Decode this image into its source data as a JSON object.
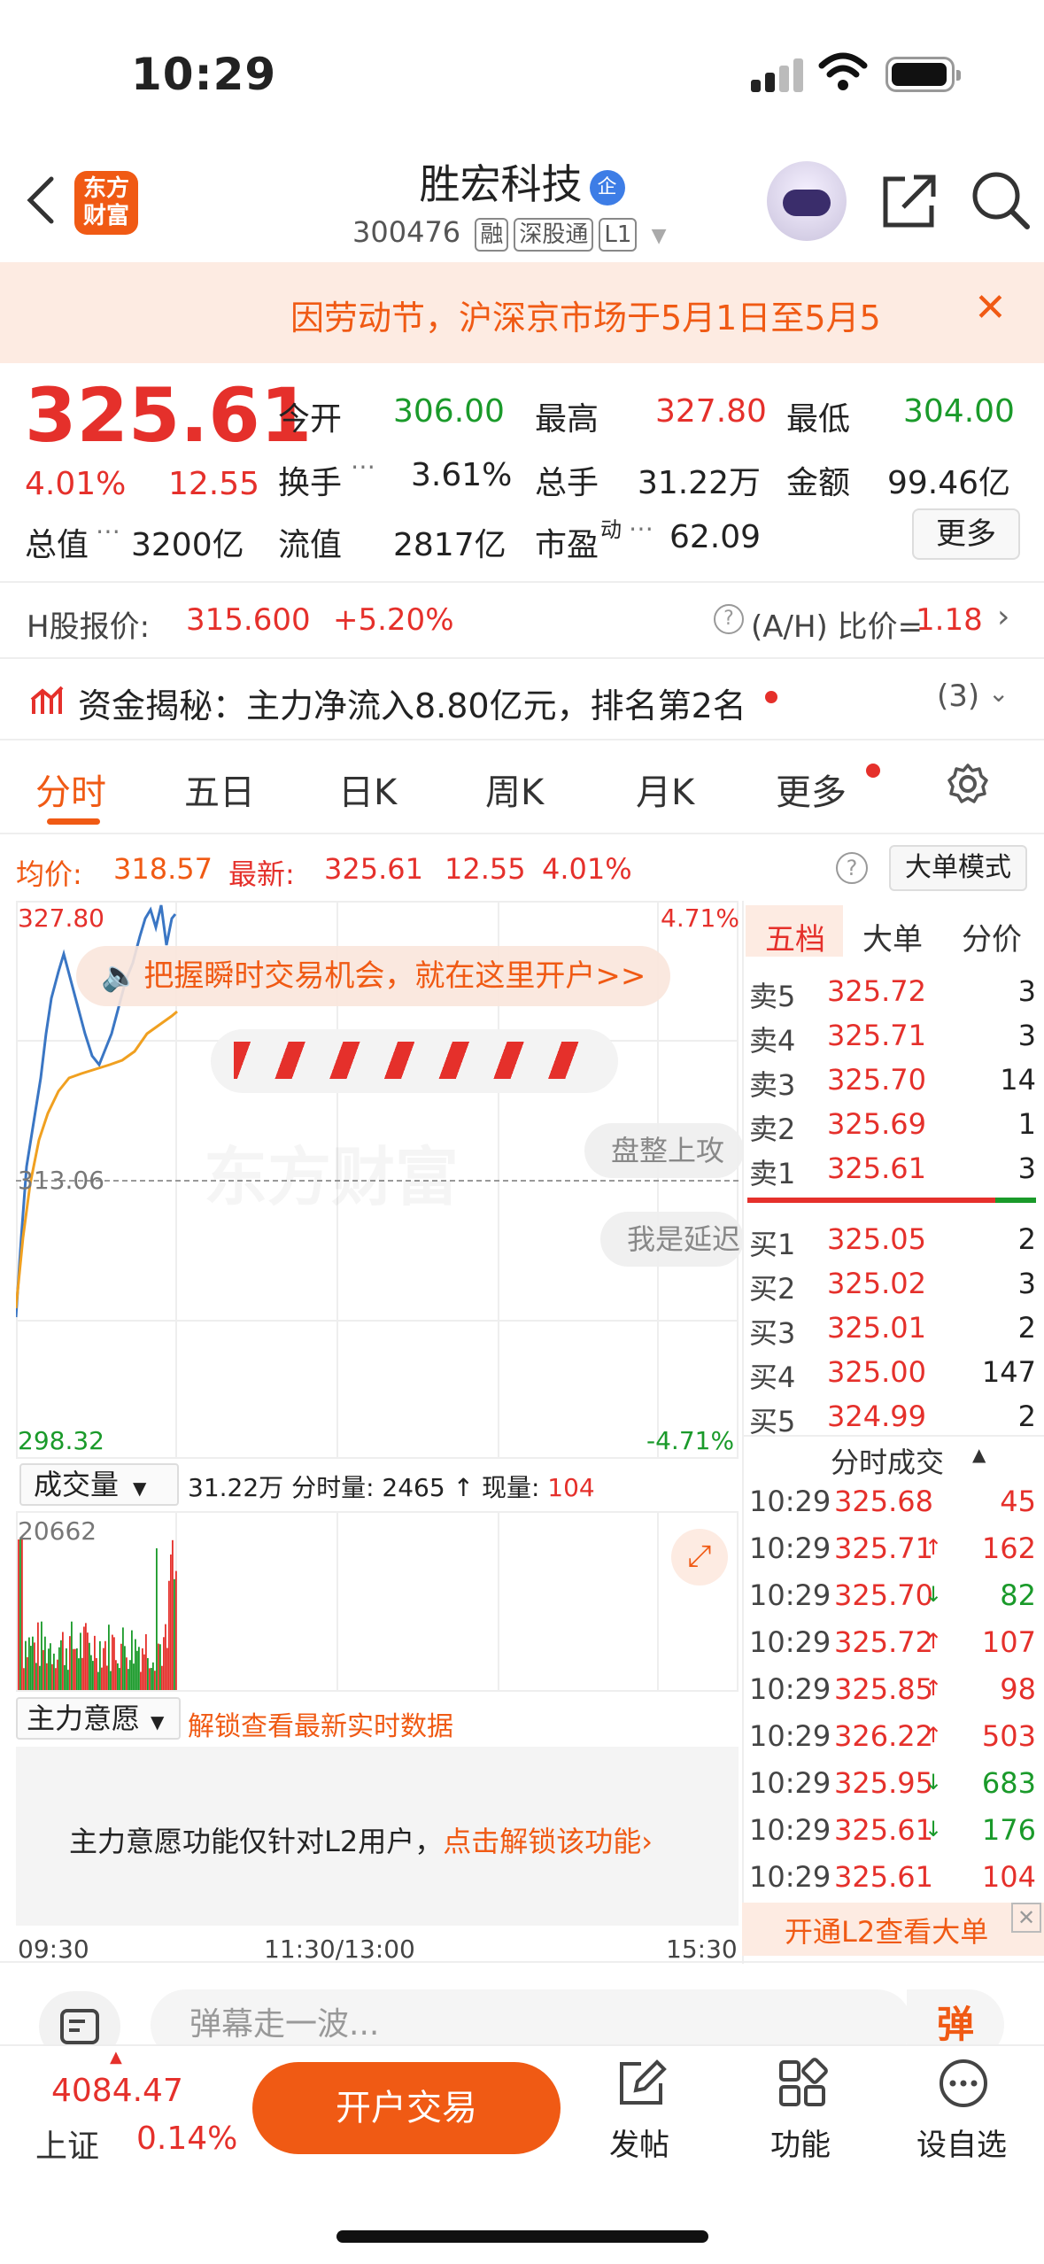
{
  "status": {
    "time": "10:29"
  },
  "header": {
    "logo_line1": "东方",
    "logo_line2": "财富",
    "stock_name": "胜宏科技",
    "qi_badge": "企",
    "code": "300476",
    "tags": [
      "融",
      "深股通",
      "L1"
    ]
  },
  "notice": {
    "text": "因劳动节，沪深京市场于5月1日至5月5",
    "close": "✕"
  },
  "quote": {
    "price": "325.61",
    "change_pct": "4.01%",
    "change": "12.55",
    "open_label": "今开",
    "open": "306.00",
    "high_label": "最高",
    "high": "327.80",
    "low_label": "最低",
    "low": "304.00",
    "turnover_label": "换手",
    "turnover": "3.61%",
    "volume_label": "总手",
    "volume": "31.22万",
    "amount_label": "金额",
    "amount": "99.46亿",
    "mcap_label": "总值",
    "mcap": "3200亿",
    "float_label": "流值",
    "float": "2817亿",
    "pe_label": "市盈",
    "pe_sup": "动",
    "pe": "62.09",
    "more": "更多"
  },
  "hshare": {
    "label": "H股报价:",
    "price": "315.600",
    "pct": "+5.20%",
    "ratio": "(A/H) 比价=",
    "ratio_val": "1.18"
  },
  "capital": {
    "text": "资金揭秘：主力净流入8.80亿元，排名第2名",
    "count": "(3)"
  },
  "tabs": [
    "分时",
    "五日",
    "日K",
    "周K",
    "月K",
    "更多"
  ],
  "chart_info": {
    "avg_label": "均价:",
    "avg": "318.57",
    "latest_label": "最新:",
    "latest": "325.61",
    "chg": "12.55",
    "pct": "4.01%",
    "mode": "大单模式"
  },
  "chart": {
    "y_top": "327.80",
    "y_mid": "313.06",
    "y_bot": "298.32",
    "pct_top": "4.71%",
    "pct_bot": "-4.71%",
    "promo": "把握瞬时交易机会，就在这里开户>>",
    "watermark": "东方财富",
    "danmu1": "盘整上攻",
    "danmu2": "我是延迟"
  },
  "volume": {
    "selector": "成交量",
    "summary_total": "31.22万",
    "summary_min_label": "分时量:",
    "summary_min": "2465",
    "summary_now_label": "现量:",
    "summary_now": "104",
    "max": "20662"
  },
  "main_force": {
    "selector": "主力意愿",
    "unlock": "解锁查看最新实时数据",
    "msg": "主力意愿功能仅针对L2用户，",
    "link": "点击解锁该功能"
  },
  "time_axis": [
    "09:30",
    "11:30/13:00",
    "15:30"
  ],
  "orderbook": {
    "tabs": [
      "五档",
      "大单",
      "分价"
    ],
    "asks": [
      {
        "l": "卖5",
        "p": "325.72",
        "v": "3"
      },
      {
        "l": "卖4",
        "p": "325.71",
        "v": "3"
      },
      {
        "l": "卖3",
        "p": "325.70",
        "v": "14"
      },
      {
        "l": "卖2",
        "p": "325.69",
        "v": "1"
      },
      {
        "l": "卖1",
        "p": "325.61",
        "v": "3"
      }
    ],
    "bids": [
      {
        "l": "买1",
        "p": "325.05",
        "v": "2"
      },
      {
        "l": "买2",
        "p": "325.02",
        "v": "3"
      },
      {
        "l": "买3",
        "p": "325.01",
        "v": "2"
      },
      {
        "l": "买4",
        "p": "325.00",
        "v": "147"
      },
      {
        "l": "买5",
        "p": "324.99",
        "v": "2"
      }
    ]
  },
  "trades": {
    "title": "分时成交",
    "rows": [
      {
        "t": "10:29",
        "p": "325.68",
        "v": "45",
        "d": "",
        "c": "red"
      },
      {
        "t": "10:29",
        "p": "325.71",
        "v": "162",
        "d": "↑",
        "c": "red"
      },
      {
        "t": "10:29",
        "p": "325.70",
        "v": "82",
        "d": "↓",
        "c": "green"
      },
      {
        "t": "10:29",
        "p": "325.72",
        "v": "107",
        "d": "↑",
        "c": "red"
      },
      {
        "t": "10:29",
        "p": "325.85",
        "v": "98",
        "d": "↑",
        "c": "red"
      },
      {
        "t": "10:29",
        "p": "326.22",
        "v": "503",
        "d": "↑",
        "c": "red"
      },
      {
        "t": "10:29",
        "p": "325.95",
        "v": "683",
        "d": "↓",
        "c": "green"
      },
      {
        "t": "10:29",
        "p": "325.61",
        "v": "176",
        "d": "↓",
        "c": "green"
      },
      {
        "t": "10:29",
        "p": "325.61",
        "v": "104",
        "d": "",
        "c": "red"
      }
    ],
    "l2_banner": "开通L2查看大单"
  },
  "bottom": {
    "danmu_placeholder": "弹幕走一波...",
    "danmu_btn": "弹",
    "index_value": "4084.47",
    "index_name": "上证",
    "index_pct": "0.14%",
    "trade_btn": "开户交易",
    "post": "发帖",
    "func": "功能",
    "watch": "设自选"
  }
}
